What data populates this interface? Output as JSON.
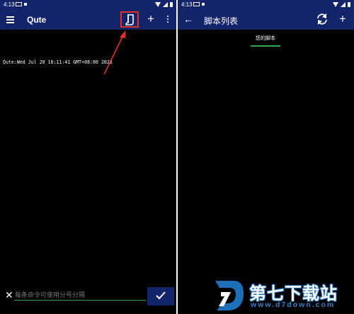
{
  "left": {
    "status": {
      "time": "4:13"
    },
    "appbar": {
      "title": "Qute"
    },
    "terminal": {
      "output": "Qute:Wed Jul 20 16:11:41 GMT+08:00 2022"
    },
    "command": {
      "placeholder": "每条命令可使用分号分隔"
    },
    "colors": {
      "bar": "#13246b",
      "highlight": "#e0302a",
      "accent": "#2ba84f"
    },
    "icons": [
      "menu-icon",
      "script-icon",
      "plus-icon",
      "overflow-icon",
      "close-icon",
      "check-icon"
    ]
  },
  "right": {
    "status": {
      "time": "4:13"
    },
    "appbar": {
      "title": "脚本列表"
    },
    "tabs": [
      {
        "label": "您的脚本",
        "selected": true
      }
    ],
    "icons": [
      "back-icon",
      "refresh-icon",
      "plus-icon"
    ]
  },
  "watermark": {
    "name": "第七下载站",
    "url": "www.d7down.com"
  }
}
